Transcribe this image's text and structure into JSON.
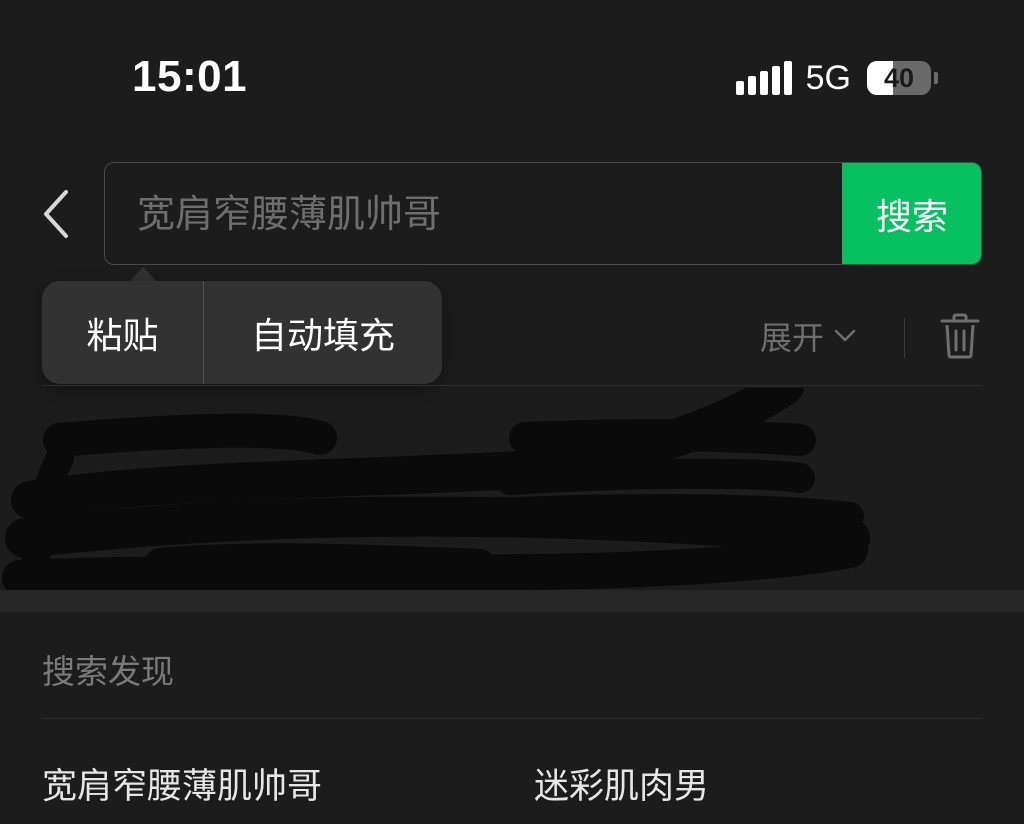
{
  "status_bar": {
    "time": "15:01",
    "network_type": "5G",
    "battery_level": "40",
    "battery_fraction": 0.4,
    "signal_bars": 5
  },
  "search": {
    "placeholder": "宽肩窄腰薄肌帅哥",
    "value": "",
    "button_label": "搜索"
  },
  "context_menu": {
    "items": [
      "粘贴",
      "自动填充"
    ]
  },
  "history": {
    "expand_label": "展开"
  },
  "discover": {
    "title": "搜索发现",
    "items": [
      "宽肩窄腰薄肌帅哥",
      "迷彩肌肉男"
    ]
  },
  "colors": {
    "accent": "#07c160",
    "background": "#1c1c1c",
    "menu_background": "#323232",
    "muted_text": "#7a7a7a"
  },
  "icons": {
    "back": "chevron-left-icon",
    "expand": "chevron-down-icon",
    "delete": "trash-icon"
  }
}
